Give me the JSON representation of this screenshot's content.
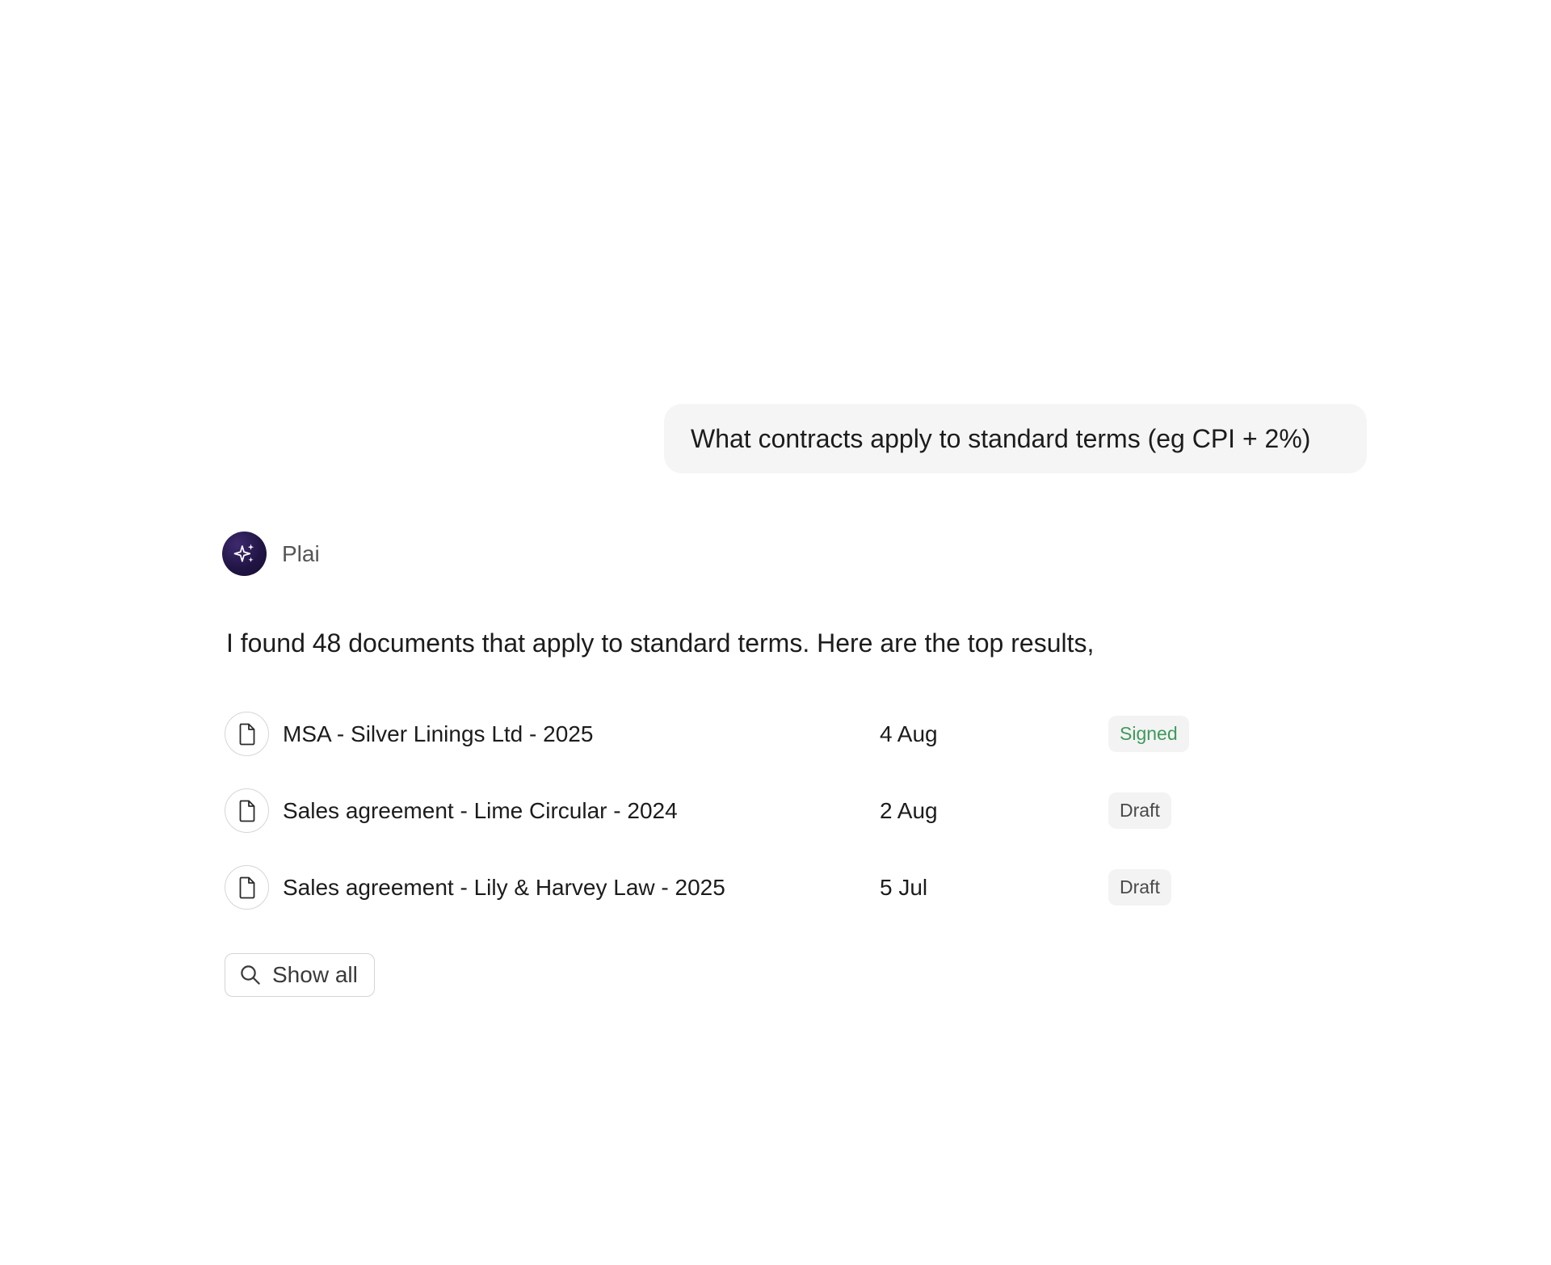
{
  "conversation": {
    "user_message": "What contracts apply to standard terms (eg CPI + 2%)",
    "assistant": {
      "name": "Plai",
      "avatar_icon": "sparkles-icon",
      "answer": "I found 48 documents that apply to standard terms. Here are the top results,"
    },
    "results": [
      {
        "title": "MSA - Silver Linings Ltd - 2025",
        "date": "4 Aug",
        "status": "Signed",
        "icon": "document-icon"
      },
      {
        "title": "Sales agreement - Lime Circular - 2024",
        "date": "2 Aug",
        "status": "Draft",
        "icon": "document-icon"
      },
      {
        "title": "Sales agreement - Lily & Harvey Law - 2025",
        "date": "5 Jul",
        "status": "Draft",
        "icon": "document-icon"
      }
    ],
    "show_all_label": "Show all"
  },
  "colors": {
    "signed_status": "#3e9a5c",
    "draft_status": "#4a4a4a",
    "avatar_bg": "#221546",
    "bubble_bg": "#f5f5f5"
  }
}
